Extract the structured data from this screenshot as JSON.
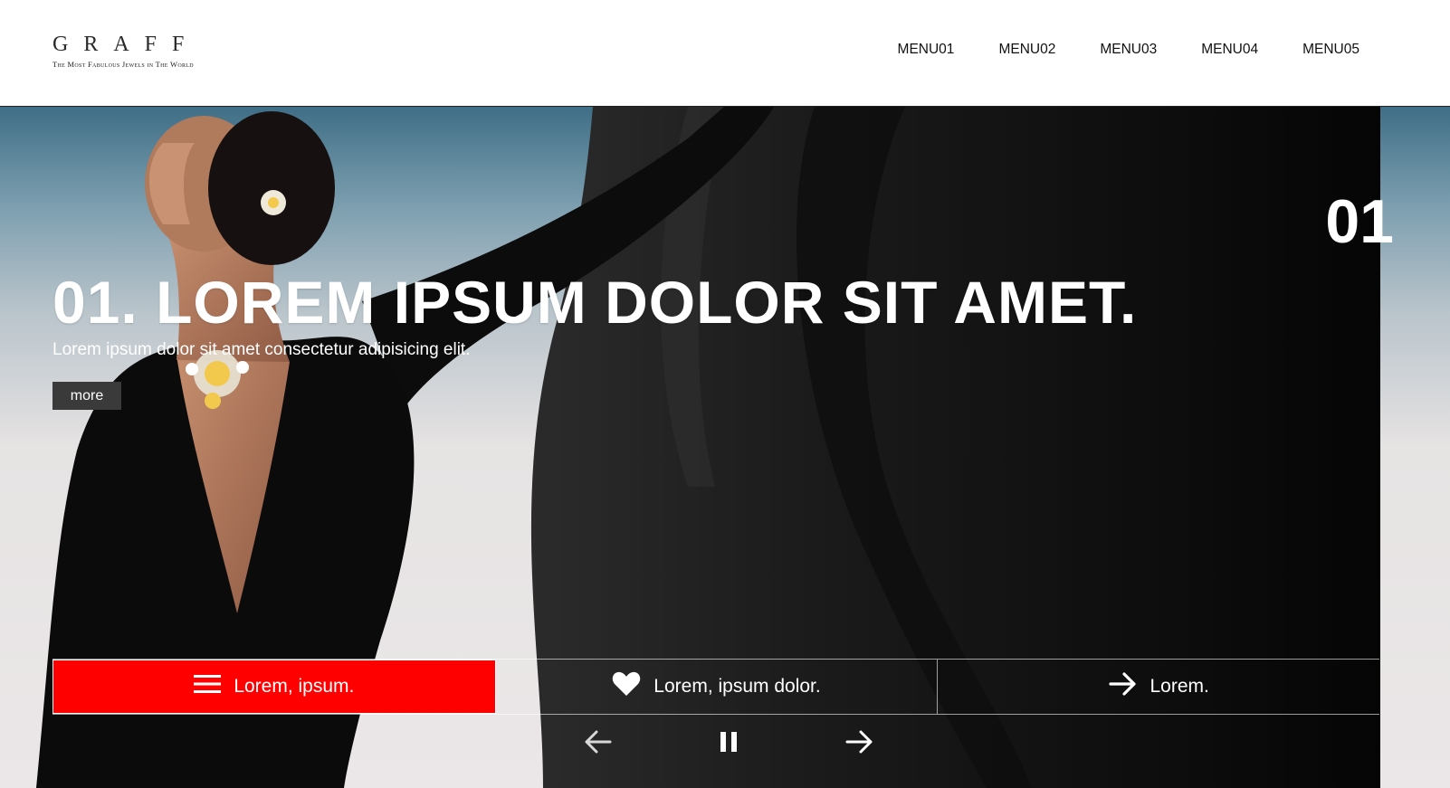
{
  "logo": {
    "wordmark": "GRAFF",
    "tagline": "The Most Fabulous Jewels in The World"
  },
  "nav": {
    "items": [
      {
        "label": "MENU01"
      },
      {
        "label": "MENU02"
      },
      {
        "label": "MENU03"
      },
      {
        "label": "MENU04"
      },
      {
        "label": "MENU05"
      }
    ]
  },
  "hero": {
    "slide_number": "01",
    "title": "01. LOREM IPSUM DOLOR SIT AMET.",
    "subtitle": "Lorem ipsum dolor sit amet consectetur adipisicing elit.",
    "more_label": "more"
  },
  "features": [
    {
      "label": "Lorem, ipsum.",
      "icon": "menu-icon",
      "active": true
    },
    {
      "label": "Lorem, ipsum dolor.",
      "icon": "heart-icon",
      "active": false
    },
    {
      "label": "Lorem.",
      "icon": "arrow-right-icon",
      "active": false
    }
  ],
  "controls": {
    "prev_icon": "arrow-left-icon",
    "pause_icon": "pause-icon",
    "next_icon": "arrow-right-icon"
  },
  "colors": {
    "accent": "#ff0000",
    "header_bg": "#ffffff",
    "text_dark": "#111111"
  }
}
